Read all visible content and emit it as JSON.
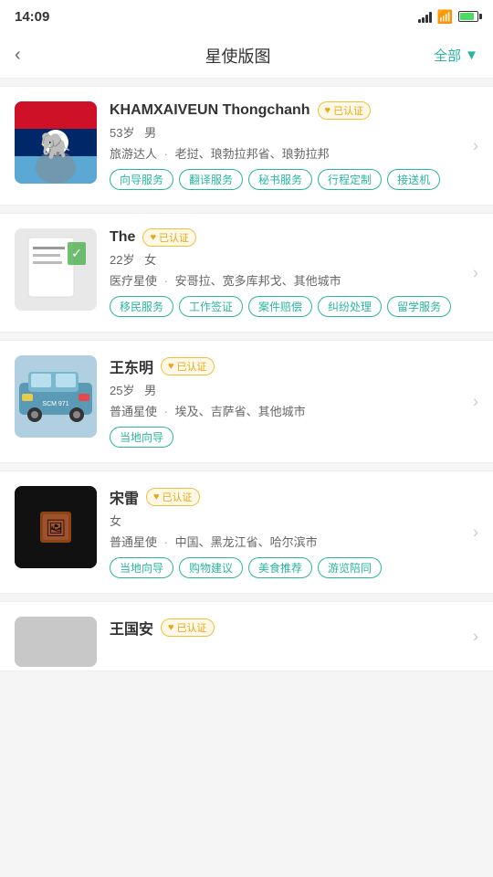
{
  "statusBar": {
    "time": "14:09"
  },
  "header": {
    "backLabel": "‹",
    "title": "星使版图",
    "rightLabel": "全部",
    "rightArrow": "›"
  },
  "cards": [
    {
      "id": "card-1",
      "name": "KHAMXAIVEUN Thongchanh",
      "verified": "已认证",
      "age": "53岁",
      "gender": "男",
      "role": "旅游达人",
      "location": "老挝、琅勃拉邦省、琅勃拉邦",
      "tags": [
        "向导服务",
        "翻译服务",
        "秘书服务",
        "行程定制",
        "接送机"
      ],
      "avatarType": "laos",
      "avatarEmoji": "🐘"
    },
    {
      "id": "card-2",
      "name": "The",
      "verified": "已认证",
      "age": "22岁",
      "gender": "女",
      "role": "医疗星使",
      "location": "安哥拉、宽多库邦戈、其他城市",
      "tags": [
        "移民服务",
        "工作签证",
        "案件赔偿",
        "纠纷处理",
        "留学服务"
      ],
      "avatarType": "doc"
    },
    {
      "id": "card-3",
      "name": "王东明",
      "verified": "已认证",
      "age": "25岁",
      "gender": "男",
      "role": "普通星使",
      "location": "埃及、吉萨省、其他城市",
      "tags": [
        "当地向导"
      ],
      "avatarType": "car"
    },
    {
      "id": "card-4",
      "name": "宋雷",
      "verified": "已认证",
      "age": "",
      "gender": "女",
      "role": "普通星使",
      "location": "中国、黑龙江省、哈尔滨市",
      "tags": [
        "当地向导",
        "购物建议",
        "美食推荐",
        "游览陪同"
      ],
      "avatarType": "black"
    },
    {
      "id": "card-5",
      "name": "王国安",
      "verified": "已认证",
      "age": "",
      "gender": "",
      "role": "",
      "location": "",
      "tags": [],
      "avatarType": "partial"
    }
  ],
  "verifiedText": "已认证",
  "dotSeparator": "·"
}
